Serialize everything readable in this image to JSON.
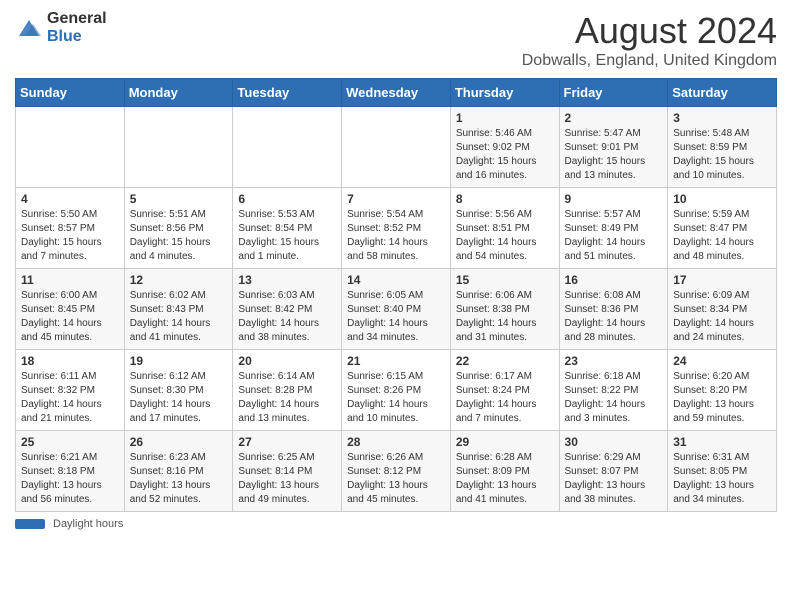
{
  "header": {
    "logo_general": "General",
    "logo_blue": "Blue",
    "title": "August 2024",
    "subtitle": "Dobwalls, England, United Kingdom"
  },
  "calendar": {
    "weekdays": [
      "Sunday",
      "Monday",
      "Tuesday",
      "Wednesday",
      "Thursday",
      "Friday",
      "Saturday"
    ],
    "weeks": [
      [
        {
          "day": "",
          "info": ""
        },
        {
          "day": "",
          "info": ""
        },
        {
          "day": "",
          "info": ""
        },
        {
          "day": "",
          "info": ""
        },
        {
          "day": "1",
          "info": "Sunrise: 5:46 AM\nSunset: 9:02 PM\nDaylight: 15 hours and 16 minutes."
        },
        {
          "day": "2",
          "info": "Sunrise: 5:47 AM\nSunset: 9:01 PM\nDaylight: 15 hours and 13 minutes."
        },
        {
          "day": "3",
          "info": "Sunrise: 5:48 AM\nSunset: 8:59 PM\nDaylight: 15 hours and 10 minutes."
        }
      ],
      [
        {
          "day": "4",
          "info": "Sunrise: 5:50 AM\nSunset: 8:57 PM\nDaylight: 15 hours and 7 minutes."
        },
        {
          "day": "5",
          "info": "Sunrise: 5:51 AM\nSunset: 8:56 PM\nDaylight: 15 hours and 4 minutes."
        },
        {
          "day": "6",
          "info": "Sunrise: 5:53 AM\nSunset: 8:54 PM\nDaylight: 15 hours and 1 minute."
        },
        {
          "day": "7",
          "info": "Sunrise: 5:54 AM\nSunset: 8:52 PM\nDaylight: 14 hours and 58 minutes."
        },
        {
          "day": "8",
          "info": "Sunrise: 5:56 AM\nSunset: 8:51 PM\nDaylight: 14 hours and 54 minutes."
        },
        {
          "day": "9",
          "info": "Sunrise: 5:57 AM\nSunset: 8:49 PM\nDaylight: 14 hours and 51 minutes."
        },
        {
          "day": "10",
          "info": "Sunrise: 5:59 AM\nSunset: 8:47 PM\nDaylight: 14 hours and 48 minutes."
        }
      ],
      [
        {
          "day": "11",
          "info": "Sunrise: 6:00 AM\nSunset: 8:45 PM\nDaylight: 14 hours and 45 minutes."
        },
        {
          "day": "12",
          "info": "Sunrise: 6:02 AM\nSunset: 8:43 PM\nDaylight: 14 hours and 41 minutes."
        },
        {
          "day": "13",
          "info": "Sunrise: 6:03 AM\nSunset: 8:42 PM\nDaylight: 14 hours and 38 minutes."
        },
        {
          "day": "14",
          "info": "Sunrise: 6:05 AM\nSunset: 8:40 PM\nDaylight: 14 hours and 34 minutes."
        },
        {
          "day": "15",
          "info": "Sunrise: 6:06 AM\nSunset: 8:38 PM\nDaylight: 14 hours and 31 minutes."
        },
        {
          "day": "16",
          "info": "Sunrise: 6:08 AM\nSunset: 8:36 PM\nDaylight: 14 hours and 28 minutes."
        },
        {
          "day": "17",
          "info": "Sunrise: 6:09 AM\nSunset: 8:34 PM\nDaylight: 14 hours and 24 minutes."
        }
      ],
      [
        {
          "day": "18",
          "info": "Sunrise: 6:11 AM\nSunset: 8:32 PM\nDaylight: 14 hours and 21 minutes."
        },
        {
          "day": "19",
          "info": "Sunrise: 6:12 AM\nSunset: 8:30 PM\nDaylight: 14 hours and 17 minutes."
        },
        {
          "day": "20",
          "info": "Sunrise: 6:14 AM\nSunset: 8:28 PM\nDaylight: 14 hours and 13 minutes."
        },
        {
          "day": "21",
          "info": "Sunrise: 6:15 AM\nSunset: 8:26 PM\nDaylight: 14 hours and 10 minutes."
        },
        {
          "day": "22",
          "info": "Sunrise: 6:17 AM\nSunset: 8:24 PM\nDaylight: 14 hours and 7 minutes."
        },
        {
          "day": "23",
          "info": "Sunrise: 6:18 AM\nSunset: 8:22 PM\nDaylight: 14 hours and 3 minutes."
        },
        {
          "day": "24",
          "info": "Sunrise: 6:20 AM\nSunset: 8:20 PM\nDaylight: 13 hours and 59 minutes."
        }
      ],
      [
        {
          "day": "25",
          "info": "Sunrise: 6:21 AM\nSunset: 8:18 PM\nDaylight: 13 hours and 56 minutes."
        },
        {
          "day": "26",
          "info": "Sunrise: 6:23 AM\nSunset: 8:16 PM\nDaylight: 13 hours and 52 minutes."
        },
        {
          "day": "27",
          "info": "Sunrise: 6:25 AM\nSunset: 8:14 PM\nDaylight: 13 hours and 49 minutes."
        },
        {
          "day": "28",
          "info": "Sunrise: 6:26 AM\nSunset: 8:12 PM\nDaylight: 13 hours and 45 minutes."
        },
        {
          "day": "29",
          "info": "Sunrise: 6:28 AM\nSunset: 8:09 PM\nDaylight: 13 hours and 41 minutes."
        },
        {
          "day": "30",
          "info": "Sunrise: 6:29 AM\nSunset: 8:07 PM\nDaylight: 13 hours and 38 minutes."
        },
        {
          "day": "31",
          "info": "Sunrise: 6:31 AM\nSunset: 8:05 PM\nDaylight: 13 hours and 34 minutes."
        }
      ]
    ]
  },
  "footer": {
    "daylight_label": "Daylight hours"
  }
}
